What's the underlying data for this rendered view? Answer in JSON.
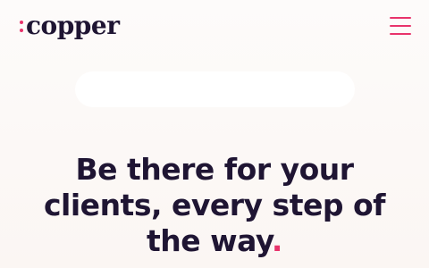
{
  "header": {
    "logo_text": "copper",
    "menu_icon": "hamburger-menu-icon"
  },
  "search": {
    "placeholder": ""
  },
  "hero": {
    "line1": "Be there for your",
    "line2": "clients, every step of",
    "line3_text": "the way",
    "line3_punct": "."
  },
  "colors": {
    "brand_pink": "#e8336b",
    "text_dark": "#1f1533",
    "background": "#fbf6f3",
    "pill": "#ffffff"
  }
}
